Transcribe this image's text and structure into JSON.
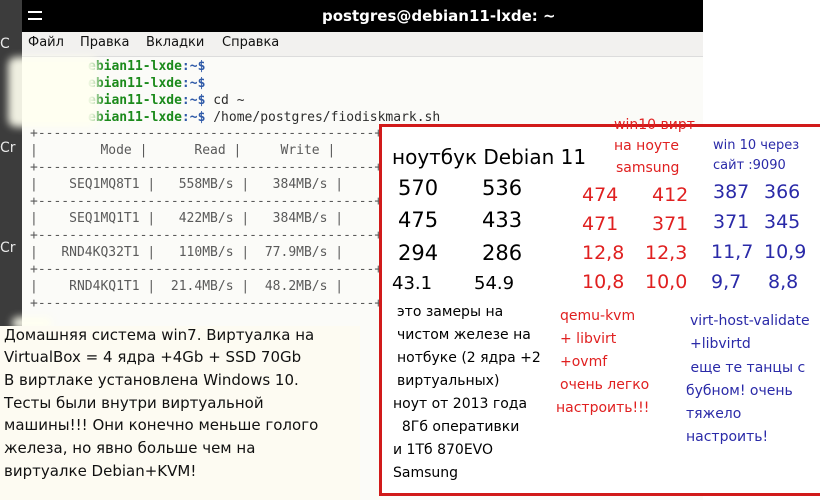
{
  "window": {
    "title": "postgres@debian11-lxde: ~"
  },
  "desktop": {
    "labels": [
      "C",
      "Cr",
      "Cr"
    ]
  },
  "menu": [
    "Файл",
    "Правка",
    "Вкладки",
    "Справка"
  ],
  "terminal": {
    "lines": [
      {
        "host": "ebian11-lxde",
        "path": ":~$",
        "cmd": ""
      },
      {
        "host": "ebian11-lxde",
        "path": ":~$",
        "cmd": ""
      },
      {
        "host": "ebian11-lxde",
        "path": ":~$",
        "cmd": " cd ~"
      },
      {
        "host": "ebian11-lxde",
        "path": ":~$",
        "cmd": " /home/postgres/fiodiskmark.sh"
      }
    ],
    "table": {
      "headers": [
        "Mode",
        "Read",
        "Write"
      ],
      "rows": [
        [
          "SEQ1MQ8T1",
          "558MB/s",
          "384MB/s"
        ],
        [
          "SEQ1MQ1T1",
          "422MB/s",
          "384MB/s"
        ],
        [
          "RND4KQ32T1",
          "110MB/s",
          "77.9MB/s"
        ],
        [
          "RND4KQ1T1",
          "21.4MB/s",
          "48.2MB/s"
        ]
      ]
    }
  },
  "note": {
    "lines": [
      "Домашняя система win7. Виртуалка на",
      "VirtualBox =  4 ядра +4Gb + SSD 70Gb",
      " В виртлаке установлена Windows 10.",
      " Тесты были внутри виртуальной",
      "машины!!!   Они конечно меньше голого",
      "железа, но явно больше чем на",
      "виртуалке Debian+KVM!"
    ]
  },
  "box": {
    "col1": {
      "title": "ноутбук Debian 11",
      "values": [
        [
          "570",
          "536"
        ],
        [
          "475",
          "433"
        ],
        [
          "294",
          "286"
        ],
        [
          "43.1",
          "54.9"
        ]
      ],
      "desc": [
        "это замеры на",
        "чистом железе на",
        "нотбуке (2 ядра +2",
        "виртуальных)",
        "ноут от 2013 года",
        "  8Гб оперативки",
        "и 1Тб 870EVO",
        "Samsung"
      ]
    },
    "col2": {
      "title": [
        "win10 вирт",
        "на ноуте",
        "samsung"
      ],
      "values": [
        [
          "474",
          "412"
        ],
        [
          "471",
          "371"
        ],
        [
          "12,8",
          "12,3"
        ],
        [
          "10,8",
          "10,0"
        ]
      ],
      "desc": [
        "qemu-kvm",
        "+ libvirt",
        "+ovmf",
        "очень легко",
        "настроить!!!"
      ]
    },
    "col3": {
      "title": [
        "win 10 через",
        "сайт :9090"
      ],
      "values": [
        [
          "387",
          "366"
        ],
        [
          "371",
          "345"
        ],
        [
          "11,7",
          "10,9"
        ],
        [
          "9,7",
          "8,8"
        ]
      ],
      "desc": [
        "virt-host-validate",
        "+libvirtd",
        " еще те танцы с",
        "бубном! очень",
        "тяжело",
        "настроить!"
      ]
    }
  },
  "colors": {
    "red": "#e02020",
    "blue": "#2a2aa8",
    "border": "#d11a1a",
    "host_green": "#1b8a1b"
  }
}
